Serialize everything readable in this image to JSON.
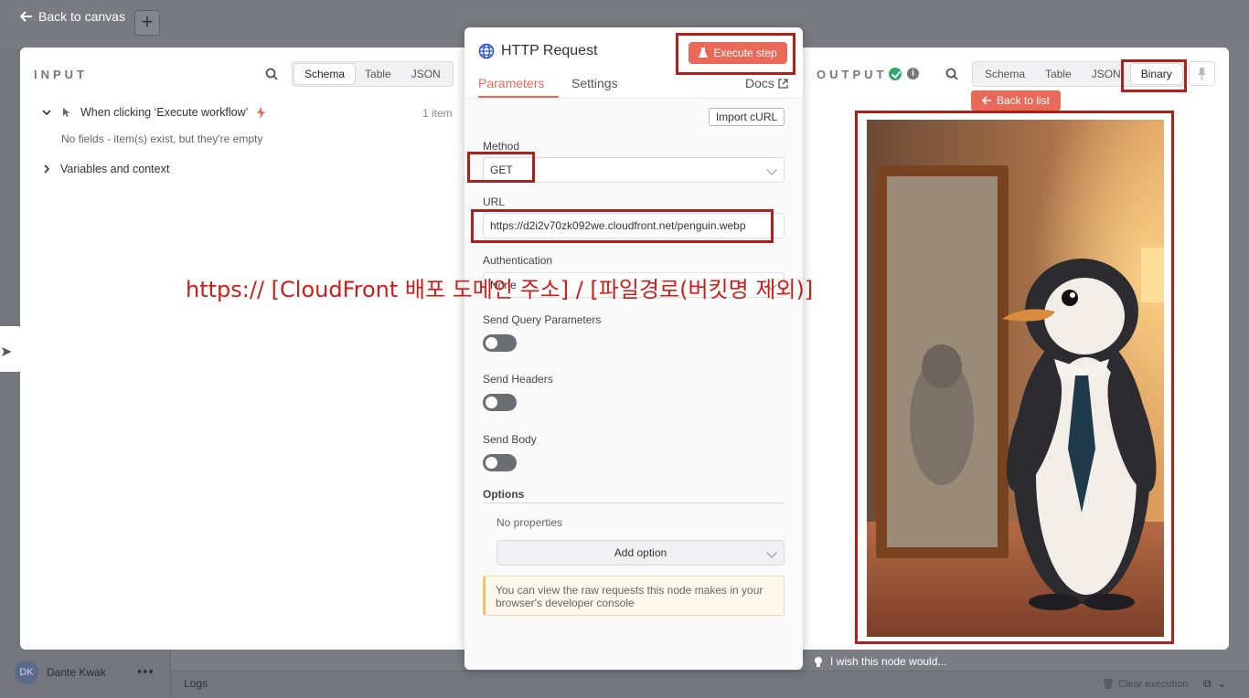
{
  "app": {
    "back_to_canvas": "Back to canvas",
    "user_initials": "DK",
    "user_name": "Dante Kwak",
    "logs_label": "Logs",
    "clear_execution": "Clear execution",
    "wish_text": "I wish this node would..."
  },
  "input_panel": {
    "title": "INPUT",
    "views": [
      "Schema",
      "Table",
      "JSON"
    ],
    "active_view": "Schema",
    "trigger_name": "When clicking ‘Execute workflow’",
    "item_count": "1 item",
    "no_fields_text": "No fields - item(s) exist, but they're empty",
    "variables_label": "Variables and context"
  },
  "node": {
    "title": "HTTP Request",
    "execute_label": "Execute step",
    "tabs": [
      "Parameters",
      "Settings"
    ],
    "active_tab": "Parameters",
    "docs_label": "Docs",
    "import_curl_label": "Import cURL",
    "method_label": "Method",
    "method_value": "GET",
    "url_label": "URL",
    "url_value": "https://d2i2v70zk092we.cloudfront.net/penguin.webp",
    "auth_label": "Authentication",
    "auth_value": "None",
    "send_query_label": "Send Query Parameters",
    "send_headers_label": "Send Headers",
    "send_body_label": "Send Body",
    "options_label": "Options",
    "no_properties_label": "No properties",
    "add_option_label": "Add option",
    "notice_text": "You can view the raw requests this node makes in your browser's developer console"
  },
  "output_panel": {
    "title": "OUTPUT",
    "views": [
      "Schema",
      "Table",
      "JSON",
      "Binary"
    ],
    "active_view": "Binary",
    "back_to_list_label": "Back to list"
  },
  "annotation": {
    "text": "https:// [CloudFront 배포 도메인 주소] / [파일경로(버킷명 제외)]"
  },
  "colors": {
    "accent": "#ea6a5a",
    "success": "#2fa66a",
    "highlight": "#b0201a"
  }
}
